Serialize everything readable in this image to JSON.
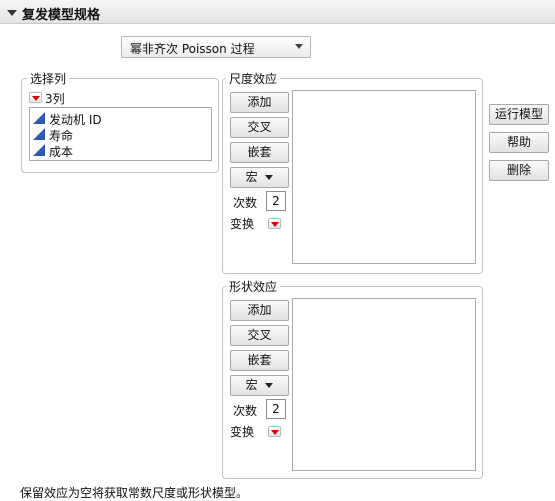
{
  "title": "复发模型规格",
  "model_select": {
    "value": "幂非齐次 Poisson 过程"
  },
  "select_columns": {
    "label": "选择列",
    "count": "3列",
    "columns": [
      "发动机 ID",
      "寿命",
      "成本"
    ]
  },
  "scale_effects": {
    "label": "尺度效应",
    "add": "添加",
    "cross": "交叉",
    "nest": "嵌套",
    "macro": "宏",
    "degree_label": "次数",
    "degree_value": "2",
    "transform_label": "变换"
  },
  "shape_effects": {
    "label": "形状效应",
    "add": "添加",
    "cross": "交叉",
    "nest": "嵌套",
    "macro": "宏",
    "degree_label": "次数",
    "degree_value": "2",
    "transform_label": "变换"
  },
  "actions": {
    "run": "运行模型",
    "help": "帮助",
    "remove": "删除"
  },
  "footer_note": "保留效应为空将获取常数尺度或形状模型。",
  "colors": {
    "accent_red": "#d00000",
    "column_icon_blue": "#2a5db0"
  }
}
